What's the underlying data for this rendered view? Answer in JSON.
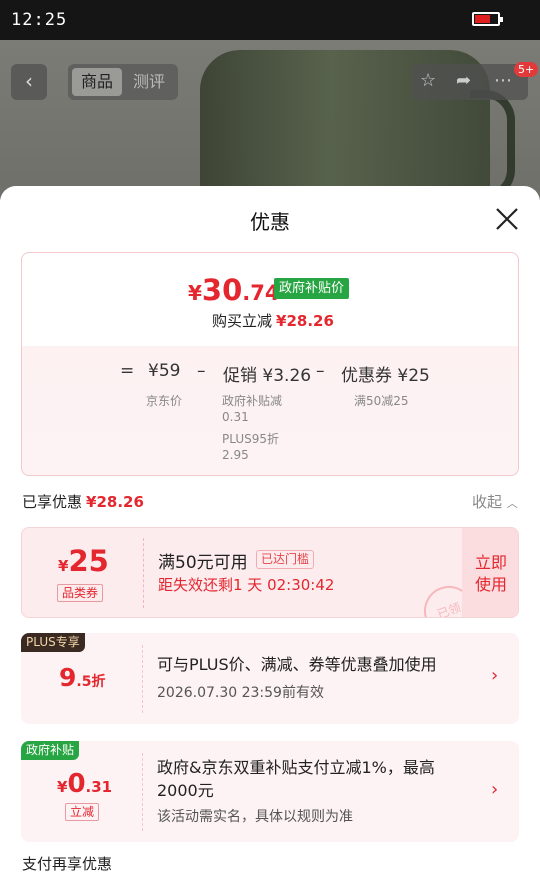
{
  "status_bar": {
    "time": "12:25",
    "battery_level": 0.7,
    "battery_color": "#e02020"
  },
  "background_page": {
    "back_icon": "chevron-left-icon",
    "tabs": [
      "商品",
      "测评"
    ],
    "actions": [
      "star-icon",
      "share-icon",
      "more-icon"
    ],
    "cart_badge": "5+"
  },
  "sheet": {
    "title": "优惠",
    "close_icon": "close-icon",
    "summary": {
      "final_price_currency": "¥",
      "final_price_int": "30",
      "final_price_dec": ".74",
      "gov_tag": "政府补贴价",
      "reduce_label": "购买立减",
      "reduce_amount": "¥28.26",
      "formula": {
        "eq": "=",
        "jd_price": "¥59",
        "minus1": "–",
        "promo": "促销 ¥3.26",
        "minus2": "–",
        "coupon": "优惠券 ¥25",
        "jd_price_label": "京东价",
        "promo_details": [
          "政府补贴减",
          "0.31",
          "PLUS95折",
          "2.95"
        ],
        "coupon_detail": "满50减25"
      }
    },
    "enjoyed_label": "已享优惠",
    "enjoyed_amount": "¥28.26",
    "collapse_label": "收起",
    "coupon": {
      "currency": "¥",
      "value": "25",
      "type": "品类券",
      "title": "满50元可用",
      "tag": "已达门槛",
      "countdown": "距失效还剩1 天 02:30:42",
      "use_label_line1": "立即",
      "use_label_line2": "使用",
      "stamp": "已领"
    },
    "plus_offer": {
      "badge": "PLUS专享",
      "value_int": "9",
      "value_dec": ".5折",
      "title": "可与PLUS价、满减、券等优惠叠加使用",
      "validity": "2026.07.30 23:59前有效"
    },
    "gov_offer": {
      "badge": "政府补贴",
      "currency": "¥",
      "value_int": "0",
      "value_dec": ".31",
      "type": "立减",
      "title_line1": "政府&京东双重补贴支付立减1%，最高",
      "title_line2": "2000元",
      "note": "该活动需实名，具体以规则为准"
    },
    "pay_more_label": "支付再享优惠"
  }
}
